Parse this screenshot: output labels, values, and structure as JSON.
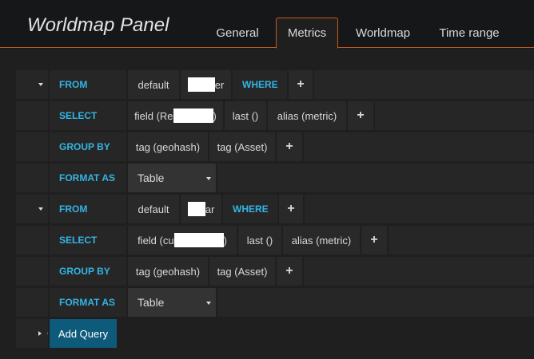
{
  "panel": {
    "title": "Worldmap Panel"
  },
  "tabs": [
    {
      "label": "General"
    },
    {
      "label": "Metrics"
    },
    {
      "label": "Worldmap"
    },
    {
      "label": "Time range"
    }
  ],
  "active_tab": "Metrics",
  "queries": [
    {
      "ref": "A",
      "from": {
        "keyword": "FROM",
        "policy": "default",
        "measurement_visible": "er",
        "where": "WHERE",
        "add": "+"
      },
      "select": {
        "keyword": "SELECT",
        "field_prefix": "field (Re",
        "field_suffix": ")",
        "fn": "last ()",
        "alias": "alias (metric)",
        "add": "+"
      },
      "group_by": {
        "keyword": "GROUP BY",
        "tags": [
          "tag (geohash)",
          "tag (Asset)"
        ],
        "add": "+"
      },
      "format_as": {
        "keyword": "FORMAT AS",
        "value": "Table"
      }
    },
    {
      "ref": "B",
      "from": {
        "keyword": "FROM",
        "policy": "default",
        "measurement_visible": "ar",
        "where": "WHERE",
        "add": "+"
      },
      "select": {
        "keyword": "SELECT",
        "field_prefix": "field (cu",
        "field_suffix": ")",
        "fn": "last ()",
        "alias": "alias (metric)",
        "add": "+"
      },
      "group_by": {
        "keyword": "GROUP BY",
        "tags": [
          "tag (geohash)",
          "tag (Asset)"
        ],
        "add": "+"
      },
      "format_as": {
        "keyword": "FORMAT AS",
        "value": "Table"
      }
    }
  ],
  "next_ref": "C",
  "add_query_label": "Add Query",
  "colors": {
    "accent_orange": "#c15c17",
    "keyword_blue": "#33b5e5",
    "add_query_bg": "#0e5a7a"
  }
}
